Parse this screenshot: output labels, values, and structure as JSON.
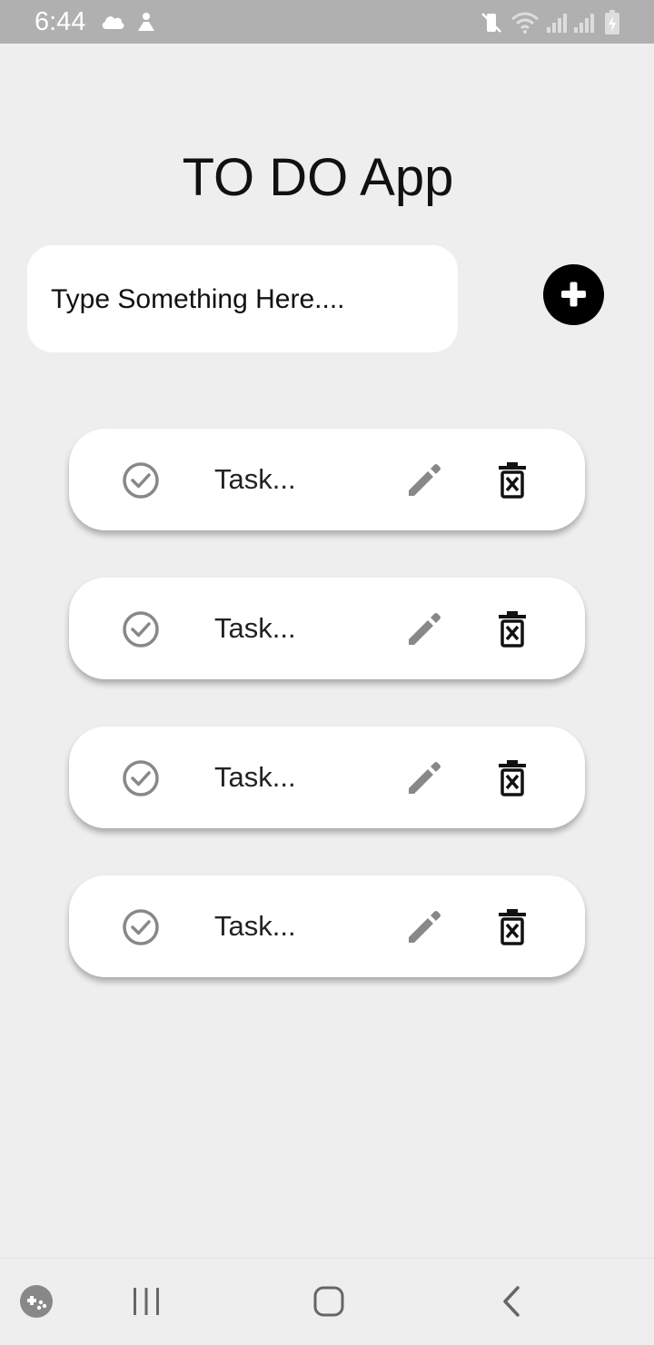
{
  "status_bar": {
    "time": "6:44",
    "icons": [
      "cloud-icon",
      "notification-icon",
      "vibrate-off-icon",
      "wifi-icon",
      "signal-icon",
      "signal-icon",
      "battery-charging-icon"
    ]
  },
  "app": {
    "title": "TO DO App"
  },
  "input": {
    "placeholder": "Type Something Here....",
    "value": ""
  },
  "add_button": {
    "icon": "plus-icon"
  },
  "tasks": [
    {
      "label": "Task..."
    },
    {
      "label": "Task..."
    },
    {
      "label": "Task..."
    },
    {
      "label": "Task..."
    }
  ],
  "task_icons": {
    "check": "check-circle-icon",
    "edit": "pencil-icon",
    "delete": "trash-icon"
  },
  "nav_bar": {
    "items": [
      "game-launcher-icon",
      "recent-apps-icon",
      "home-icon",
      "back-icon"
    ]
  },
  "colors": {
    "background": "#eeeeee",
    "card": "#ffffff",
    "status_bar": "#b0b0b0",
    "accent": "#000000",
    "icon_gray": "#888888"
  }
}
